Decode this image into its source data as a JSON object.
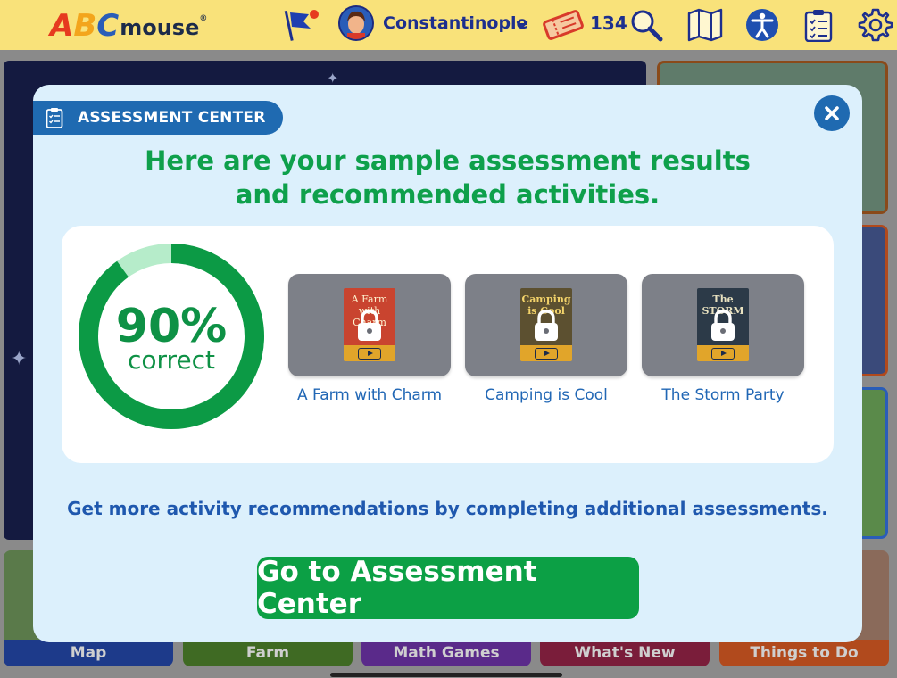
{
  "topbar": {
    "logo": {
      "a": "A",
      "b": "B",
      "c": "C",
      "mouse": "mouse",
      "reg": "®"
    },
    "user_name": "Constantinople",
    "ticket_count": "134",
    "icons": [
      "flag-icon",
      "avatar",
      "chevron-down-icon",
      "ticket-icon",
      "search-icon",
      "map-icon",
      "accessibility-icon",
      "checklist-icon",
      "gear-icon"
    ],
    "bar_color": "#f9e27a",
    "text_color": "#1d2f8e"
  },
  "background": {
    "bottom_tiles": [
      {
        "label": "Map",
        "color": "#1d3a8a"
      },
      {
        "label": "Farm",
        "color": "#3f6a23"
      },
      {
        "label": "Math Games",
        "color": "#5a2a8a"
      },
      {
        "label": "What's New",
        "color": "#7a1d3a"
      },
      {
        "label": "Things to Do",
        "color": "#b14a1d"
      }
    ]
  },
  "modal": {
    "tag_label": "ASSESSMENT CENTER",
    "headline_line1": "Here are your sample assessment results",
    "headline_line2": "and recommended activities.",
    "score": {
      "percent_text": "90%",
      "label": "correct",
      "fraction": 0.9
    },
    "activities": [
      {
        "title": "A Farm with Charm",
        "cover_text": "A Farm with Charm",
        "cover_color": "#c94a3a",
        "locked": true
      },
      {
        "title": "Camping is Cool",
        "cover_text": "Camping is Cool",
        "cover_color": "#5a4a2a",
        "locked": true
      },
      {
        "title": "The Storm Party",
        "cover_text": "The STORM",
        "cover_color": "#2a3a4a",
        "locked": true
      }
    ],
    "more_text": "Get more activity recommendations by completing additional assessments.",
    "cta_label": "Go to Assessment Center",
    "colors": {
      "accent_green": "#0ca045",
      "brand_blue": "#1f6ab1",
      "modal_bg": "#dcf0fc"
    }
  }
}
